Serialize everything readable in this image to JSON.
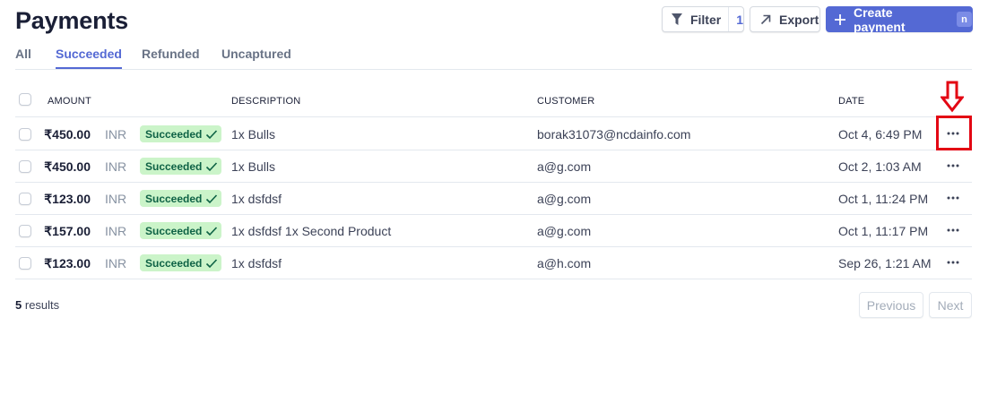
{
  "page": {
    "title": "Payments"
  },
  "toolbar": {
    "filter_label": "Filter",
    "filter_count": "1",
    "export_label": "Export",
    "create_label": "Create payment",
    "create_shortcut": "n"
  },
  "tabs": [
    {
      "label": "All",
      "active": false
    },
    {
      "label": "Succeeded",
      "active": true
    },
    {
      "label": "Refunded",
      "active": false
    },
    {
      "label": "Uncaptured",
      "active": false
    }
  ],
  "table": {
    "headers": {
      "amount": "AMOUNT",
      "description": "DESCRIPTION",
      "customer": "CUSTOMER",
      "date": "DATE"
    },
    "rows": [
      {
        "amount": "₹450.00",
        "currency": "INR",
        "status": "Succeeded",
        "description": "1x Bulls",
        "customer": "borak31073@ncdainfo.com",
        "date": "Oct 4, 6:49 PM"
      },
      {
        "amount": "₹450.00",
        "currency": "INR",
        "status": "Succeeded",
        "description": "1x Bulls",
        "customer": "a@g.com",
        "date": "Oct 2, 1:03 AM"
      },
      {
        "amount": "₹123.00",
        "currency": "INR",
        "status": "Succeeded",
        "description": "1x dsfdsf",
        "customer": "a@g.com",
        "date": "Oct 1, 11:24 PM"
      },
      {
        "amount": "₹157.00",
        "currency": "INR",
        "status": "Succeeded",
        "description": "1x dsfdsf 1x Second Product",
        "customer": "a@g.com",
        "date": "Oct 1, 11:17 PM"
      },
      {
        "amount": "₹123.00",
        "currency": "INR",
        "status": "Succeeded",
        "description": "1x dsfdsf",
        "customer": "a@h.com",
        "date": "Sep 26, 1:21 AM"
      }
    ]
  },
  "footer": {
    "results_count": "5",
    "results_label": "results",
    "previous_label": "Previous",
    "next_label": "Next"
  },
  "colors": {
    "accent": "#5469d4",
    "success_bg": "#cbf4c9",
    "success_text": "#0e6245",
    "annotation": "#e30613"
  },
  "icons": [
    "filter-icon",
    "export-arrow-icon",
    "plus-icon",
    "check-icon",
    "more-dots-icon",
    "down-arrow-annotation-icon"
  ]
}
